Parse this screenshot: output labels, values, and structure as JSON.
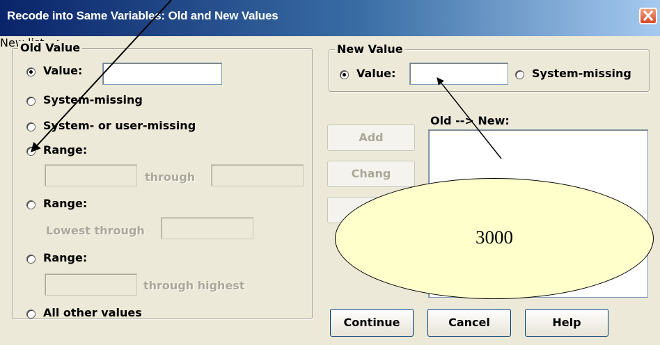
{
  "window": {
    "title": "Recode into Same Variables: Old and New Values",
    "close_glyph": "close-icon"
  },
  "old_value": {
    "legend": "Old Value",
    "value_label": "Value:",
    "value_text": "",
    "system_missing_label": "System-missing",
    "system_or_user_missing_label": "System- or user-missing",
    "range1_label": "Range:",
    "range1_through": "through",
    "range2_label": "Range:",
    "range2_lowest_through": "Lowest through",
    "range3_label": "Range:",
    "range3_through_highest": "through highest",
    "all_other_label": "All other values",
    "selected": "value"
  },
  "new_value": {
    "legend": "New Value",
    "value_label": "Value:",
    "value_text": "",
    "system_missing_label": "System-missing",
    "selected": "value"
  },
  "mapping": {
    "label": "Old --> New:",
    "items": []
  },
  "buttons": {
    "add": "Add",
    "change": "Chang",
    "remove": "",
    "continue": "Continue",
    "cancel": "Cancel",
    "help": "Help"
  },
  "annotation": {
    "callout_text": "3000",
    "callout_fill": "#ffffcc"
  },
  "colors": {
    "dialog_bg": "#ece9d8",
    "title_start": "#0a246a",
    "title_end": "#a6caf0",
    "disabled_text": "#aca899"
  }
}
